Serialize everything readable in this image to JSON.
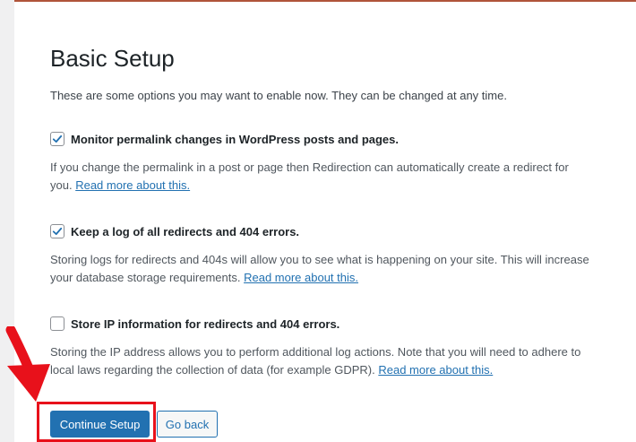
{
  "page": {
    "title": "Basic Setup",
    "intro": "These are some options you may want to enable now. They can be changed at any time."
  },
  "options": [
    {
      "label": "Monitor permalink changes in WordPress posts and pages.",
      "checked": true,
      "desc_line1": "If you change the permalink in a post or page then Redirection can automatically create a redirect for",
      "desc_line2": "you.",
      "link": "Read more about this."
    },
    {
      "label": "Keep a log of all redirects and 404 errors.",
      "checked": true,
      "desc_line1": "Storing logs for redirects and 404s will allow you to see what is happening on your site. This will increase",
      "desc_line2": "your database storage requirements.",
      "link": "Read more about this."
    },
    {
      "label": "Store IP information for redirects and 404 errors.",
      "checked": false,
      "desc_line1": "Storing the IP address allows you to perform additional log actions. Note that you will need to adhere to",
      "desc_line2": "local laws regarding the collection of data (for example GDPR).",
      "link": "Read more about this."
    }
  ],
  "buttons": {
    "continue": "Continue Setup",
    "back": "Go back"
  },
  "colors": {
    "primary": "#2271b1",
    "annotation": "#e8111b",
    "top_border": "#b0543a"
  },
  "icons": {
    "check": "check-icon",
    "arrow": "arrow-down-icon"
  }
}
